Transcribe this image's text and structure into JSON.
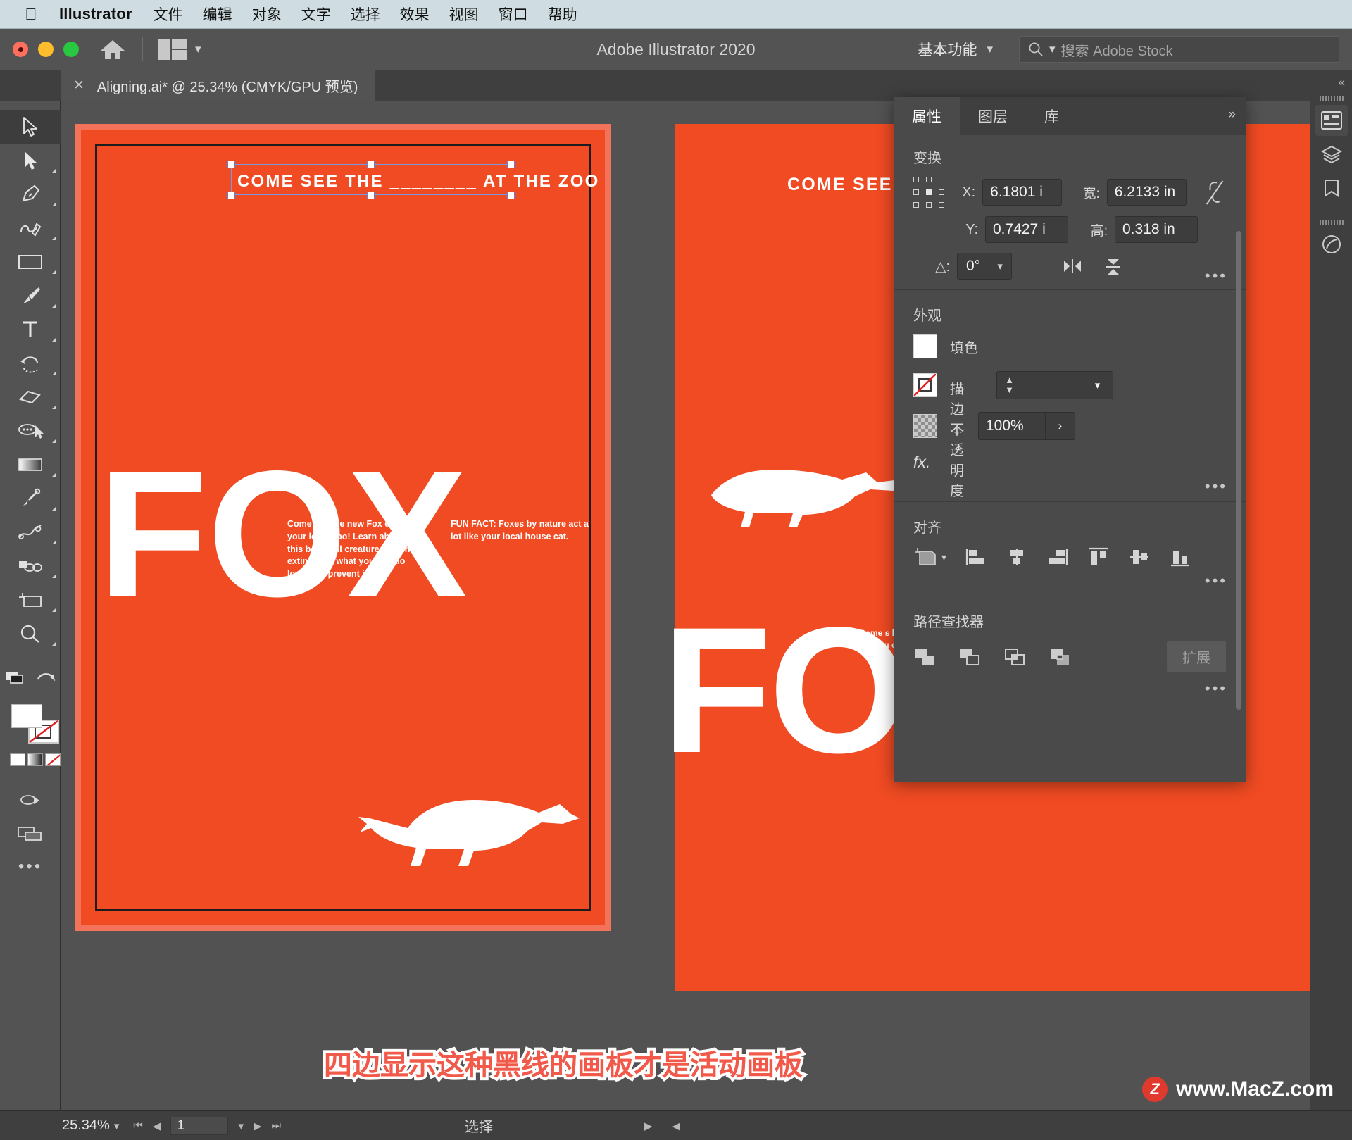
{
  "macbar": {
    "apple_icon": "apple-logo-icon",
    "app_name": "Illustrator",
    "menus": [
      "文件",
      "编辑",
      "对象",
      "文字",
      "选择",
      "效果",
      "视图",
      "窗口",
      "帮助"
    ]
  },
  "titlebar": {
    "title": "Adobe Illustrator 2020",
    "home_icon": "home-icon",
    "layout_icon": "arrange-documents-icon",
    "workspace": "基本功能",
    "workspace_chevron": "chevron-down-icon",
    "search_icon": "search-icon",
    "search_placeholder": "搜索 Adobe Stock",
    "search_value": ""
  },
  "tabs": {
    "close_icon": "close-icon",
    "documents": [
      {
        "title": "Aligning.ai* @ 25.34% (CMYK/GPU 预览)"
      }
    ]
  },
  "toolbar": {
    "tools": [
      {
        "name": "selection-tool",
        "selected": true
      },
      {
        "name": "direct-selection-tool",
        "selected": false
      },
      {
        "name": "pen-tool",
        "selected": false
      },
      {
        "name": "curvature-tool",
        "selected": false
      },
      {
        "name": "rectangle-tool",
        "selected": false
      },
      {
        "name": "paintbrush-tool",
        "selected": false
      },
      {
        "name": "type-tool",
        "selected": false
      },
      {
        "name": "rotate-tool",
        "selected": false
      },
      {
        "name": "eraser-tool",
        "selected": false
      },
      {
        "name": "shape-builder-tool",
        "selected": false
      },
      {
        "name": "gradient-tool",
        "selected": false
      },
      {
        "name": "eyedropper-tool",
        "selected": false
      },
      {
        "name": "blend-tool",
        "selected": false
      },
      {
        "name": "symbol-sprayer-tool",
        "selected": false
      },
      {
        "name": "artboard-tool",
        "selected": false
      },
      {
        "name": "zoom-tool",
        "selected": false
      }
    ],
    "fill_color": "#ffffff",
    "stroke_color": "none",
    "more_icon": "more-tools-icon"
  },
  "artboards": {
    "headline": "COME SEE THE ________ AT THE ZOO",
    "headline_2": "COME SEE TH",
    "word": "FOX",
    "body_left": "Come see the new Fox exhibit at your local Zoo! Learn about why this beautiful creature is going extinct and what you can do locally to prevent it.",
    "body_right": "FUN FACT: Foxes by nature act a lot like your local house cat.",
    "body_left_2": "Come s local Z tiful cre you can",
    "artboard_color": "#f04b23",
    "active_border_color": "#1c1c1c",
    "selection_color": "#7a9ae0"
  },
  "properties_panel": {
    "tabs": [
      {
        "label": "属性",
        "active": true
      },
      {
        "label": "图层",
        "active": false
      },
      {
        "label": "库",
        "active": false
      }
    ],
    "more_icon": "panel-menu-icon",
    "transform": {
      "title": "变换",
      "reference_point_icon": "reference-point-grid-icon",
      "x_label": "X:",
      "x_value": "6.1801 i",
      "y_label": "Y:",
      "y_value": "0.7427 i",
      "w_label": "宽:",
      "w_value": "6.2133 in",
      "h_label": "高:",
      "h_value": "0.318 in",
      "link_icon": "constrain-proportions-unlinked-icon",
      "angle_label": "△:",
      "angle_value": "0°",
      "flip_h_icon": "flip-horizontal-icon",
      "flip_v_icon": "flip-vertical-icon",
      "ellipsis": "•••"
    },
    "appearance": {
      "title": "外观",
      "fill_label": "填色",
      "fill_color": "#ffffff",
      "stroke_label": "描边",
      "stroke_color": "none",
      "stroke_weight": "",
      "stroke_chevron": "chevron-down-icon",
      "opacity_label": "不透明度",
      "opacity_value": "100%",
      "opacity_arrow": "chevron-right-icon",
      "fx_label": "fx.",
      "ellipsis": "•••"
    },
    "align": {
      "title": "对齐",
      "align_to_icon": "align-to-artboard-icon",
      "buttons": [
        "align-left-icon",
        "align-horizontal-center-icon",
        "align-right-icon",
        "align-top-icon",
        "align-vertical-center-icon",
        "align-bottom-icon"
      ],
      "ellipsis": "•••"
    },
    "pathfinder": {
      "title": "路径查找器",
      "buttons": [
        "unite-icon",
        "minus-front-icon",
        "intersect-icon",
        "exclude-icon"
      ],
      "expand_label": "扩展",
      "ellipsis": "•••"
    }
  },
  "right_dock": {
    "collapse_icon": "collapse-panel-icon",
    "icons": [
      {
        "name": "properties-dock-icon",
        "active": true
      },
      {
        "name": "layers-dock-icon",
        "active": false
      },
      {
        "name": "libraries-dock-icon",
        "active": false
      },
      {
        "name": "brushes-dock-icon",
        "active": false
      }
    ]
  },
  "statusbar": {
    "zoom_value": "25.34%",
    "zoom_chevron": "chevron-down-icon",
    "first_icon": "first-artboard-icon",
    "prev_icon": "previous-artboard-icon",
    "page_value": "1",
    "page_chevron": "chevron-down-icon",
    "next_icon": "next-artboard-icon",
    "last_icon": "last-artboard-icon",
    "status_text": "选择",
    "right_arrow_icon": "chevron-right-icon",
    "left_arrow_icon": "chevron-left-icon"
  },
  "annotation": {
    "text": "四边显示这种黑线的画板才是活动画板",
    "color": "#f15a4a"
  },
  "watermark": {
    "badge": "Z",
    "text": "www.MacZ.com"
  }
}
